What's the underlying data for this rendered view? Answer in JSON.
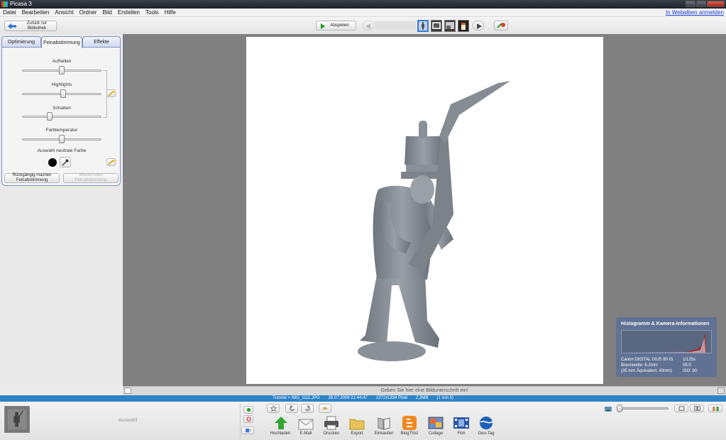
{
  "window": {
    "title": "Picasa 3"
  },
  "menu": [
    "Datei",
    "Bearbeiten",
    "Ansicht",
    "Ordner",
    "Bild",
    "Erstellen",
    "Tools",
    "Hilfe"
  ],
  "weblink": "In Webalben anmelden",
  "toolbar": {
    "back_label": "Zurück zur Bibliothek",
    "play_label": "Abspielen"
  },
  "tabs": [
    "Optimierung",
    "Feinabstimmung",
    "Effekte"
  ],
  "tuning": {
    "sliders": [
      {
        "label": "Aufhellen",
        "value": 0.5
      },
      {
        "label": "Highlights",
        "value": 0.52
      },
      {
        "label": "Schatten",
        "value": 0.35
      },
      {
        "label": "Farbtemperatur",
        "value": 0.5
      }
    ],
    "neutral_label": "Auswahl neutrale Farbe",
    "undo_label": "Rückgängig machen Feinabstimmung",
    "redo_label": "Wiederholen Feinabstimmung"
  },
  "histogram": {
    "title": "Histogramm & Kamera-Informationen",
    "camera": "Canon DIGITAL IXUS 80 IS",
    "shutter": "1/125s",
    "focal": "Brennweite: 6.2mm",
    "aperture": "f/8.0",
    "equiv": "(35 mm Äquivalent:  40mm)",
    "iso": "ISO: 80"
  },
  "caption_placeholder": "Geben Sie hier eine Bildunterschrift ein!",
  "status": {
    "path": "Tutorial > IMG_1111.JPG",
    "date": "26.07.2009 21:44:47",
    "size": "1372x1334 Pixel",
    "filesize": "2,3MB",
    "position": "(1 von 5)"
  },
  "tray": {
    "selection_label": "Auswahl",
    "tools": [
      "Hochladen",
      "E-Mail",
      "Drucken",
      "Export",
      "Einkaufen",
      "BlogThis!",
      "Collage",
      "Film",
      "Geo-Tag"
    ]
  },
  "colors": {
    "accent": "#2d84c7",
    "tab_border": "#7f92c4",
    "viewer_bg": "#808080"
  }
}
